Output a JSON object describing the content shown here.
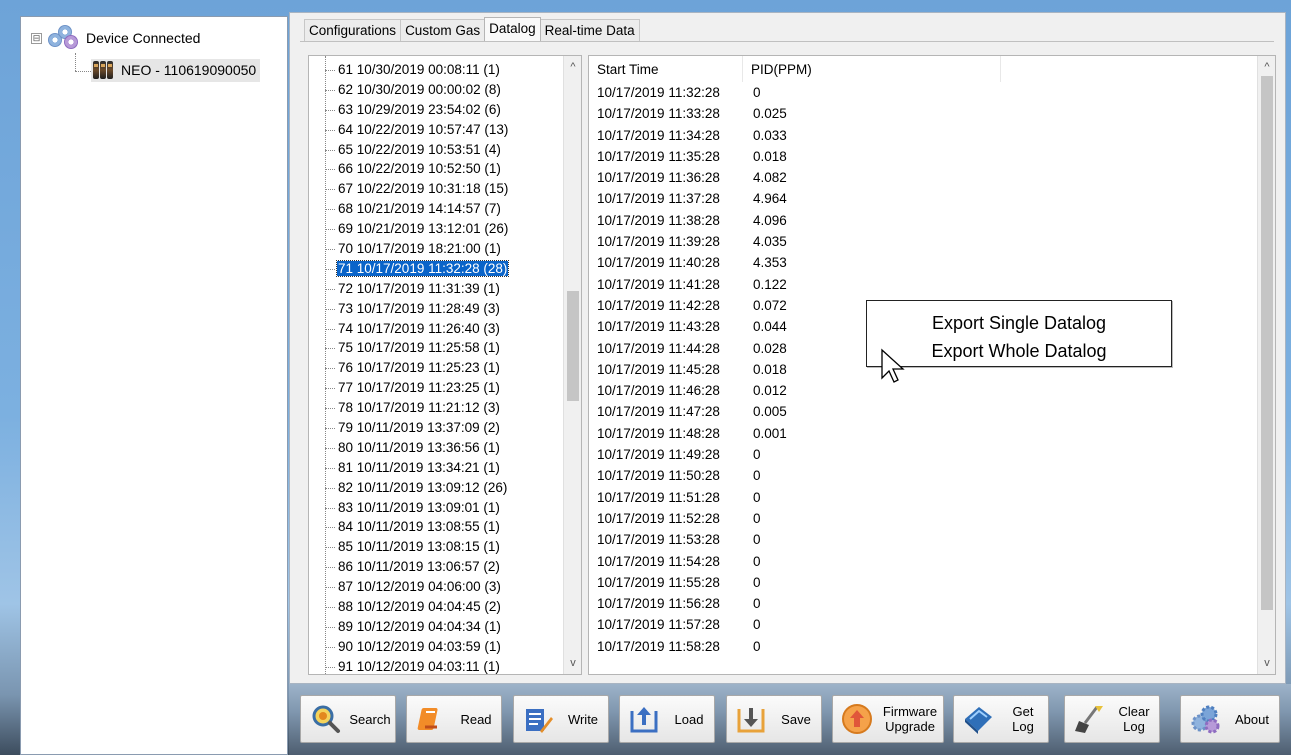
{
  "tree": {
    "root_label": "Device Connected",
    "expander": "⊟",
    "child_label": "NEO - 110619090050"
  },
  "tabs": [
    {
      "label": "Configurations",
      "active": false
    },
    {
      "label": "Custom Gas",
      "active": false
    },
    {
      "label": "Datalog",
      "active": true
    },
    {
      "label": "Real-time Data",
      "active": false
    }
  ],
  "datalog_list": [
    "61 10/30/2019 00:08:11 (1)",
    "62 10/30/2019 00:00:02 (8)",
    "63 10/29/2019 23:54:02 (6)",
    "64 10/22/2019 10:57:47 (13)",
    "65 10/22/2019 10:53:51 (4)",
    "66 10/22/2019 10:52:50 (1)",
    "67 10/22/2019 10:31:18 (15)",
    "68 10/21/2019 14:14:57 (7)",
    "69 10/21/2019 13:12:01 (26)",
    "70 10/17/2019 18:21:00 (1)",
    "71 10/17/2019 11:32:28 (28)",
    "72 10/17/2019 11:31:39 (1)",
    "73 10/17/2019 11:28:49 (3)",
    "74 10/17/2019 11:26:40 (3)",
    "75 10/17/2019 11:25:58 (1)",
    "76 10/17/2019 11:25:23 (1)",
    "77 10/17/2019 11:23:25 (1)",
    "78 10/17/2019 11:21:12 (3)",
    "79 10/11/2019 13:37:09 (2)",
    "80 10/11/2019 13:36:56 (1)",
    "81 10/11/2019 13:34:21 (1)",
    "82 10/11/2019 13:09:12 (26)",
    "83 10/11/2019 13:09:01 (1)",
    "84 10/11/2019 13:08:55 (1)",
    "85 10/11/2019 13:08:15 (1)",
    "86 10/11/2019 13:06:57 (2)",
    "87 10/12/2019 04:06:00 (3)",
    "88 10/12/2019 04:04:45 (2)",
    "89 10/12/2019 04:04:34 (1)",
    "90 10/12/2019 04:03:59 (1)",
    "91 10/12/2019 04:03:11 (1)"
  ],
  "datalog_selected_index": 10,
  "datalog_scroll": {
    "up": "^",
    "down": "v",
    "thumb_top_fraction": 0.37,
    "thumb_size_fraction": 0.19
  },
  "table": {
    "columns": [
      "Start Time",
      "PID(PPM)"
    ],
    "rows": [
      [
        "10/17/2019 11:32:28",
        "0"
      ],
      [
        "10/17/2019 11:33:28",
        "0.025"
      ],
      [
        "10/17/2019 11:34:28",
        "0.033"
      ],
      [
        "10/17/2019 11:35:28",
        "0.018"
      ],
      [
        "10/17/2019 11:36:28",
        "4.082"
      ],
      [
        "10/17/2019 11:37:28",
        "4.964"
      ],
      [
        "10/17/2019 11:38:28",
        "4.096"
      ],
      [
        "10/17/2019 11:39:28",
        "4.035"
      ],
      [
        "10/17/2019 11:40:28",
        "4.353"
      ],
      [
        "10/17/2019 11:41:28",
        "0.122"
      ],
      [
        "10/17/2019 11:42:28",
        "0.072"
      ],
      [
        "10/17/2019 11:43:28",
        "0.044"
      ],
      [
        "10/17/2019 11:44:28",
        "0.028"
      ],
      [
        "10/17/2019 11:45:28",
        "0.018"
      ],
      [
        "10/17/2019 11:46:28",
        "0.012"
      ],
      [
        "10/17/2019 11:47:28",
        "0.005"
      ],
      [
        "10/17/2019 11:48:28",
        "0.001"
      ],
      [
        "10/17/2019 11:49:28",
        "0"
      ],
      [
        "10/17/2019 11:50:28",
        "0"
      ],
      [
        "10/17/2019 11:51:28",
        "0"
      ],
      [
        "10/17/2019 11:52:28",
        "0"
      ],
      [
        "10/17/2019 11:53:28",
        "0"
      ],
      [
        "10/17/2019 11:54:28",
        "0"
      ],
      [
        "10/17/2019 11:55:28",
        "0"
      ],
      [
        "10/17/2019 11:56:28",
        "0"
      ],
      [
        "10/17/2019 11:57:28",
        "0"
      ],
      [
        "10/17/2019 11:58:28",
        "0"
      ]
    ],
    "scroll": {
      "up": "^",
      "down": "v",
      "thumb_top_fraction": 0.0,
      "thumb_size_fraction": 0.92
    }
  },
  "context_menu": {
    "items": [
      "Export Single Datalog",
      "Export Whole Datalog"
    ]
  },
  "toolbar": {
    "buttons": [
      {
        "label": "Search",
        "icon": "magnifier-icon"
      },
      {
        "label": "Read",
        "icon": "read-book-icon"
      },
      {
        "label": "Write",
        "icon": "write-document-icon"
      },
      {
        "label": "Load",
        "icon": "load-upload-icon"
      },
      {
        "label": "Save",
        "icon": "save-download-icon"
      },
      {
        "label": "Firmware\nUpgrade",
        "icon": "firmware-upgrade-icon"
      },
      {
        "label": "Get\nLog",
        "icon": "get-log-book-icon"
      },
      {
        "label": "Clear\nLog",
        "icon": "clear-log-broom-icon"
      },
      {
        "label": "About",
        "icon": "about-gears-icon"
      }
    ]
  },
  "colors": {
    "selection": "#0a64c9",
    "panel_bg": "#f0f0f0",
    "desktop_blue": "#7cb0e0"
  }
}
